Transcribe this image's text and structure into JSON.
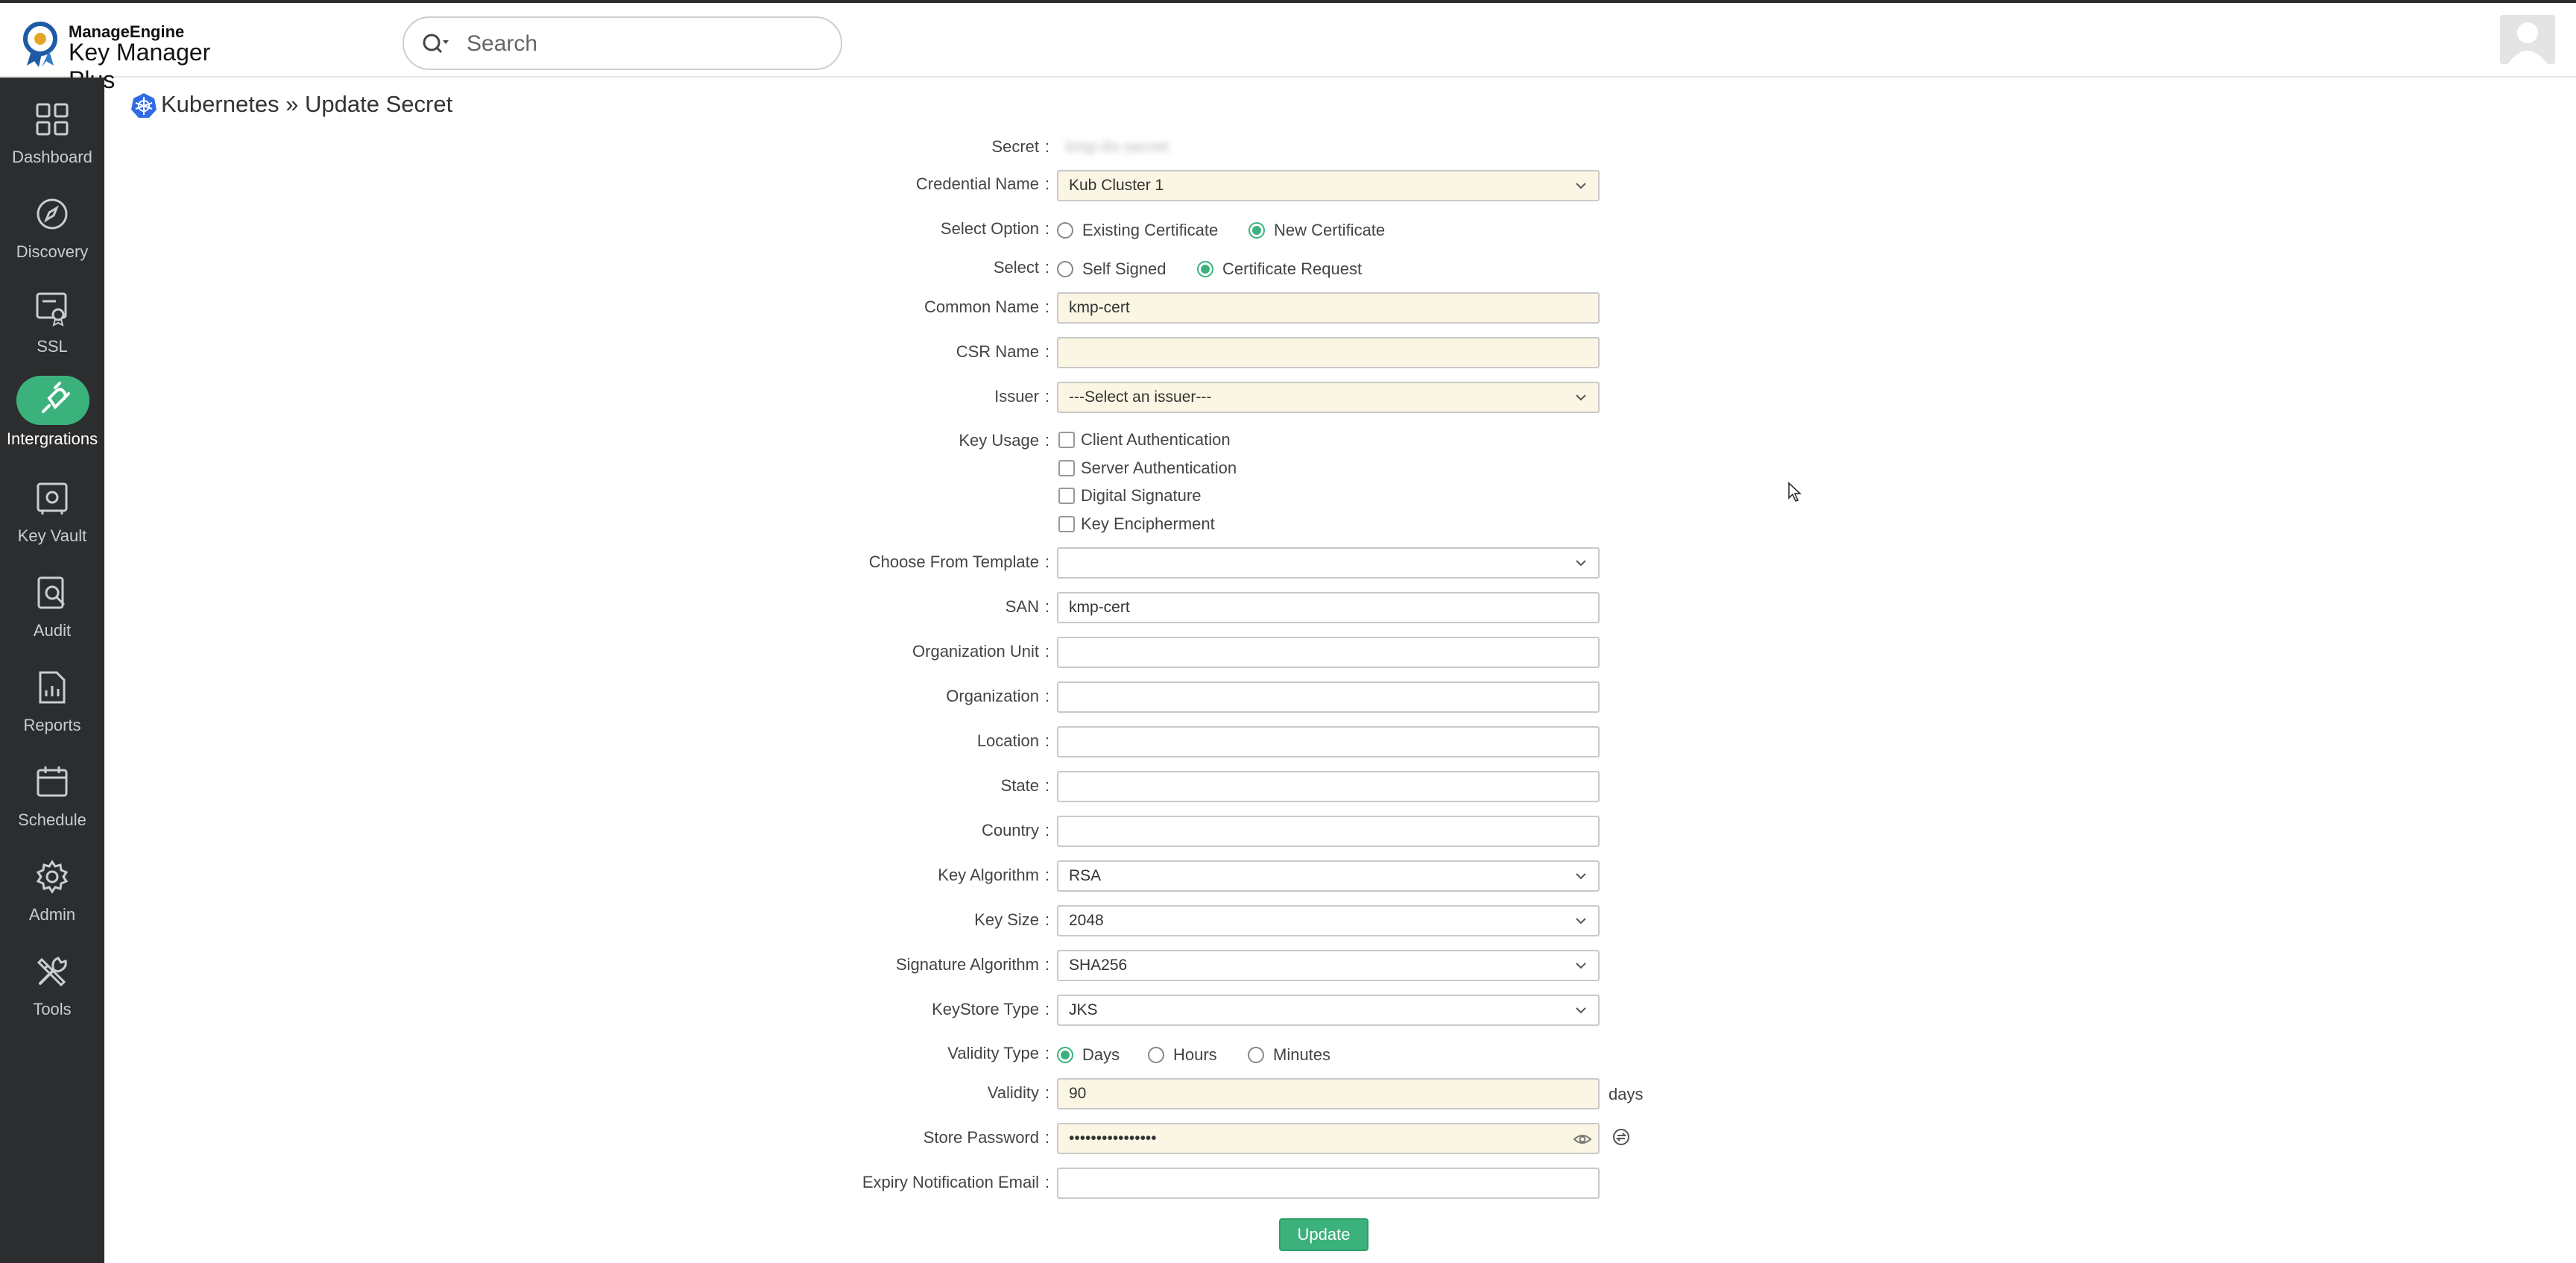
{
  "header": {
    "brand_top": "ManageEngine",
    "brand_main": "Key Manager Plus",
    "search_placeholder": "Search"
  },
  "sidebar": {
    "items": [
      {
        "label": "Dashboard",
        "icon": "dashboard-icon",
        "active": false
      },
      {
        "label": "Discovery",
        "icon": "compass-icon",
        "active": false
      },
      {
        "label": "SSL",
        "icon": "certificate-icon",
        "active": false
      },
      {
        "label": "Intergrations",
        "icon": "plug-icon",
        "active": true
      },
      {
        "label": "Key Vault",
        "icon": "vault-icon",
        "active": false
      },
      {
        "label": "Audit",
        "icon": "audit-icon",
        "active": false
      },
      {
        "label": "Reports",
        "icon": "reports-icon",
        "active": false
      },
      {
        "label": "Schedule",
        "icon": "calendar-icon",
        "active": false
      },
      {
        "label": "Admin",
        "icon": "gear-icon",
        "active": false
      },
      {
        "label": "Tools",
        "icon": "tools-icon",
        "active": false
      }
    ]
  },
  "page": {
    "title": "Kubernetes » Update Secret"
  },
  "form": {
    "colon": ":",
    "secret_label": "Secret",
    "secret_value": "kmp-tls-secret",
    "credential_label": "Credential Name",
    "credential_value": "Kub Cluster 1",
    "select_option_label": "Select Option",
    "select_option_existing": "Existing Certificate",
    "select_option_new": "New Certificate",
    "select_label": "Select",
    "select_self_signed": "Self Signed",
    "select_cert_request": "Certificate Request",
    "common_name_label": "Common Name",
    "common_name_value": "kmp-cert",
    "csr_name_label": "CSR Name",
    "csr_name_value": "",
    "issuer_label": "Issuer",
    "issuer_value": "---Select an issuer---",
    "key_usage_label": "Key Usage",
    "key_usage_options": [
      "Client Authentication",
      "Server Authentication",
      "Digital Signature",
      "Key Encipherment"
    ],
    "template_label": "Choose From Template",
    "template_value": "",
    "san_label": "SAN",
    "san_value": "kmp-cert",
    "org_unit_label": "Organization Unit",
    "org_label": "Organization",
    "location_label": "Location",
    "state_label": "State",
    "country_label": "Country",
    "key_algorithm_label": "Key Algorithm",
    "key_algorithm_value": "RSA",
    "key_size_label": "Key Size",
    "key_size_value": "2048",
    "sig_algorithm_label": "Signature Algorithm",
    "sig_algorithm_value": "SHA256",
    "keystore_label": "KeyStore Type",
    "keystore_value": "JKS",
    "validity_type_label": "Validity Type",
    "validity_days": "Days",
    "validity_hours": "Hours",
    "validity_minutes": "Minutes",
    "validity_label": "Validity",
    "validity_value": "90",
    "validity_unit": "days",
    "store_password_label": "Store Password",
    "store_password_value": "••••••••••••••••",
    "expiry_email_label": "Expiry Notification Email",
    "update_button": "Update"
  },
  "colors": {
    "accent": "#3bb27c",
    "sidebar_bg": "#2b2d2f",
    "field_highlight": "#fbf6e3"
  }
}
